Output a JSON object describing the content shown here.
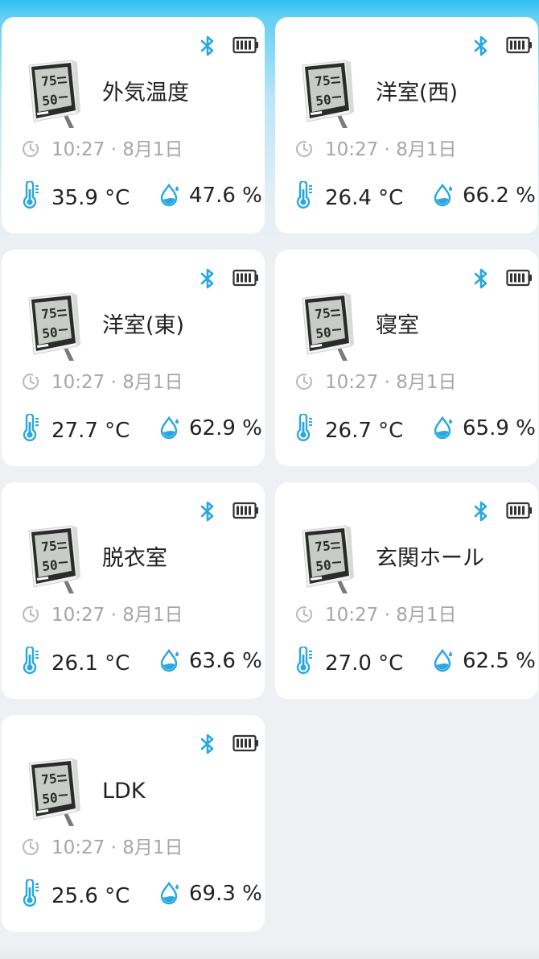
{
  "colors": {
    "accent": "#29a7df",
    "header": "#2cbef0",
    "muted_text": "#a6a6a6",
    "primary_text": "#222222",
    "card_bg": "#ffffff",
    "page_bg": "#eef0f3"
  },
  "icons": {
    "bluetooth": "bluetooth-icon",
    "battery": "battery-full-icon",
    "clock": "clock-icon",
    "temperature": "thermometer-icon",
    "humidity": "water-drop-icon",
    "device": "thermo-hygrometer-device-image"
  },
  "sensors": [
    {
      "name": "外気温度",
      "time": "10:27 · 8月1日",
      "temperature": "35.9 °C",
      "humidity": "47.6 %"
    },
    {
      "name": "洋室(西)",
      "time": "10:27 · 8月1日",
      "temperature": "26.4 °C",
      "humidity": "66.2 %"
    },
    {
      "name": "洋室(東)",
      "time": "10:27 · 8月1日",
      "temperature": "27.7 °C",
      "humidity": "62.9 %"
    },
    {
      "name": "寝室",
      "time": "10:27 · 8月1日",
      "temperature": "26.7 °C",
      "humidity": "65.9 %"
    },
    {
      "name": "脱衣室",
      "time": "10:27 · 8月1日",
      "temperature": "26.1 °C",
      "humidity": "63.6 %"
    },
    {
      "name": "玄関ホール",
      "time": "10:27 · 8月1日",
      "temperature": "27.0 °C",
      "humidity": "62.5 %"
    },
    {
      "name": "LDK",
      "time": "10:27 · 8月1日",
      "temperature": "25.6 °C",
      "humidity": "69.3 %"
    }
  ]
}
